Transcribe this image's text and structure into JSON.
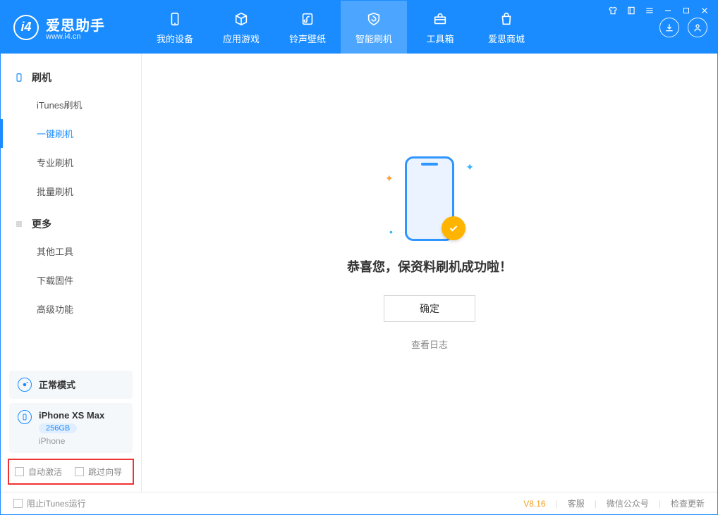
{
  "app": {
    "name": "爱思助手",
    "url": "www.i4.cn"
  },
  "headerTabs": [
    {
      "key": "device",
      "label": "我的设备"
    },
    {
      "key": "apps",
      "label": "应用游戏"
    },
    {
      "key": "ring",
      "label": "铃声壁纸"
    },
    {
      "key": "flash",
      "label": "智能刷机"
    },
    {
      "key": "tools",
      "label": "工具箱"
    },
    {
      "key": "store",
      "label": "爱思商城"
    }
  ],
  "sidebar": {
    "groups": [
      {
        "title": "刷机",
        "items": [
          {
            "key": "itunes",
            "label": "iTunes刷机"
          },
          {
            "key": "onekey",
            "label": "一键刷机"
          },
          {
            "key": "pro",
            "label": "专业刷机"
          },
          {
            "key": "batch",
            "label": "批量刷机"
          }
        ]
      },
      {
        "title": "更多",
        "items": [
          {
            "key": "other",
            "label": "其他工具"
          },
          {
            "key": "fw",
            "label": "下载固件"
          },
          {
            "key": "adv",
            "label": "高级功能"
          }
        ]
      }
    ]
  },
  "mode": {
    "label": "正常模式"
  },
  "device": {
    "name": "iPhone XS Max",
    "capacity": "256GB",
    "sub": "iPhone"
  },
  "checks": {
    "auto_activate": "自动激活",
    "skip_guide": "跳过向导"
  },
  "main": {
    "success": "恭喜您，保资料刷机成功啦！",
    "ok": "确定",
    "log": "查看日志"
  },
  "status": {
    "block_itunes": "阻止iTunes运行",
    "version": "V8.16",
    "service": "客服",
    "wechat": "微信公众号",
    "update": "检查更新"
  }
}
